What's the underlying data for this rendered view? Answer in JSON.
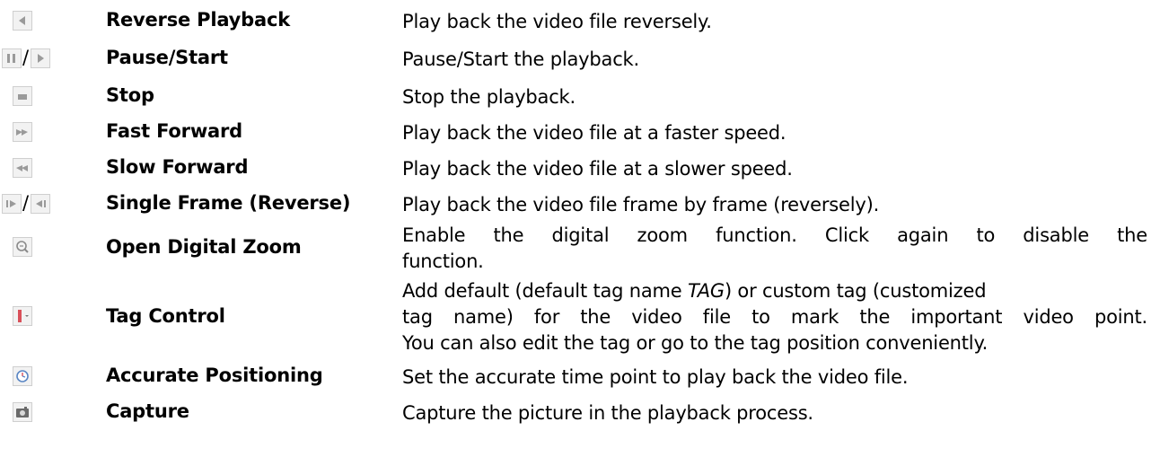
{
  "rows": [
    {
      "icon": "reverse-playback-icon",
      "name": "Reverse Playback",
      "desc": [
        "Play back the video file reversely."
      ]
    },
    {
      "icon": "pause-start-icon",
      "name": "Pause/Start",
      "desc": [
        "Pause/Start the playback."
      ]
    },
    {
      "icon": "stop-icon",
      "name": "Stop",
      "desc": [
        "Stop the playback."
      ]
    },
    {
      "icon": "fast-forward-icon",
      "name": "Fast Forward",
      "desc": [
        "Play back the video file at a faster speed."
      ]
    },
    {
      "icon": "slow-forward-icon",
      "name": "Slow Forward",
      "desc": [
        "Play back the video file at a slower speed."
      ]
    },
    {
      "icon": "single-frame-icon",
      "name": "Single Frame (Reverse)",
      "desc": [
        "Play back the video file frame by frame (reversely)."
      ]
    },
    {
      "icon": "digital-zoom-icon",
      "name": "Open Digital Zoom",
      "desc": [
        "Enable the digital zoom function. Click again to disable the",
        "function."
      ]
    },
    {
      "icon": "tag-control-icon",
      "name": "Tag Control",
      "desc": [
        "Add default (default tag name ",
        "TAG",
        ") or custom tag (customized",
        "tag name) for the video file to mark the important video point.",
        "You can also edit the tag or go to the tag position conveniently."
      ]
    },
    {
      "icon": "accurate-positioning-icon",
      "name": "Accurate Positioning",
      "desc": [
        "Set the accurate time point to play back the video file."
      ]
    },
    {
      "icon": "capture-icon",
      "name": "Capture",
      "desc": [
        "Capture the picture in the playback process."
      ]
    }
  ]
}
